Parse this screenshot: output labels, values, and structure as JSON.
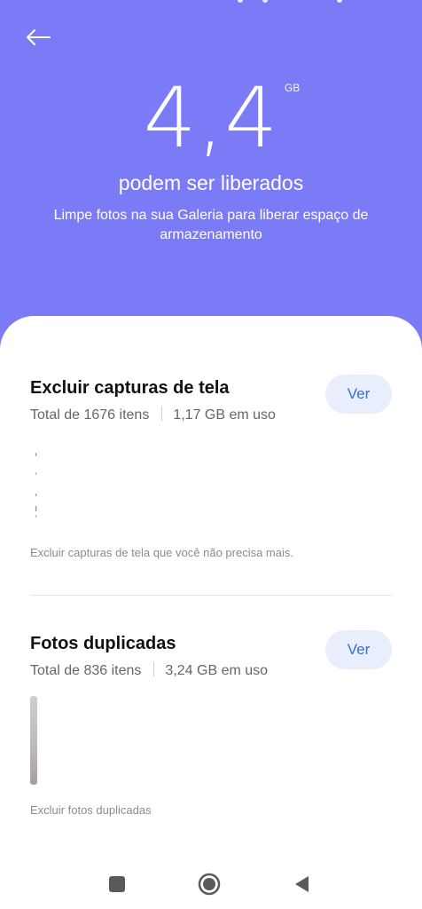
{
  "header": {
    "amount": "4,4",
    "unit": "GB",
    "subtitle": "podem ser liberados",
    "description": "Limpe fotos na sua Galeria para liberar espaço de armazenamento",
    "background_color": "#7b7bf8"
  },
  "sections": [
    {
      "title": "Excluir capturas de tela",
      "total": "Total de 1676 itens",
      "usage": "1,17 GB em uso",
      "button": "Ver",
      "note": "Excluir capturas de tela que você não precisa mais."
    },
    {
      "title": "Fotos duplicadas",
      "total": "Total de 836 itens",
      "usage": "3,24 GB em uso",
      "button": "Ver",
      "note": "Excluir fotos duplicadas"
    }
  ],
  "navbar": {
    "icons": [
      "recents-square-icon",
      "home-circle-icon",
      "back-triangle-icon"
    ]
  },
  "colors": {
    "accent": "#3a6fd8",
    "button_bg": "#e8eefc"
  }
}
